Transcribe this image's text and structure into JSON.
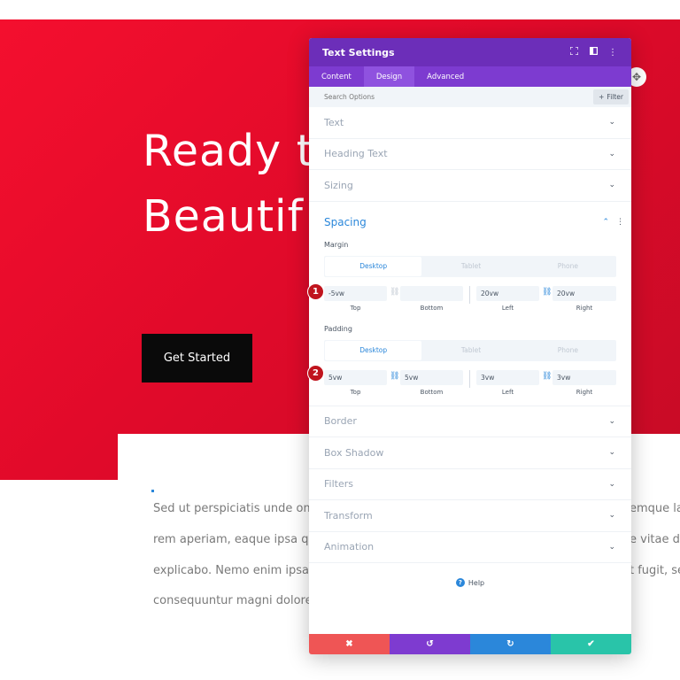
{
  "page": {
    "hero_line1": "Ready t",
    "hero_line2": "Beautif",
    "cta_label": "Get Started",
    "body_lines": [
      "Sed ut perspiciatis unde om",
      "rem aperiam, eaque ipsa q",
      "explicabo. Nemo enim ipsa",
      "consequuntur magni dolore"
    ],
    "body_lines_right": [
      "emque la",
      "e vitae d",
      "t fugit, se"
    ],
    "move_icon": "move-icon"
  },
  "modal": {
    "title": "Text Settings",
    "header_icons": [
      "fullscreen-icon",
      "split-view-icon",
      "more-vertical-icon"
    ],
    "tabs": [
      {
        "label": "Content",
        "active": false
      },
      {
        "label": "Design",
        "active": true
      },
      {
        "label": "Advanced",
        "active": false
      }
    ],
    "search_placeholder": "Search Options",
    "filter_label": "Filter",
    "toggles_top": [
      "Text",
      "Heading Text",
      "Sizing"
    ],
    "spacing": {
      "label": "Spacing",
      "margin": {
        "label": "Margin",
        "devices": [
          "Desktop",
          "Tablet",
          "Phone"
        ],
        "active_device": "Desktop",
        "top": "-5vw",
        "bottom": "",
        "left": "20vw",
        "right": "20vw",
        "top_bottom_linked": false,
        "left_right_linked": true,
        "badge": "1"
      },
      "padding": {
        "label": "Padding",
        "devices": [
          "Desktop",
          "Tablet",
          "Phone"
        ],
        "active_device": "Desktop",
        "top": "5vw",
        "bottom": "5vw",
        "left": "3vw",
        "right": "3vw",
        "top_bottom_linked": true,
        "left_right_linked": true,
        "badge": "2"
      },
      "side_labels": [
        "Top",
        "Bottom",
        "Left",
        "Right"
      ]
    },
    "toggles_bottom": [
      "Border",
      "Box Shadow",
      "Filters",
      "Transform",
      "Animation"
    ],
    "help_label": "Help",
    "footer_buttons": [
      {
        "name": "discard",
        "icon": "✖",
        "color": "#ef5555"
      },
      {
        "name": "undo",
        "icon": "↺",
        "color": "#7e3bd0"
      },
      {
        "name": "redo",
        "icon": "↻",
        "color": "#2b87da"
      },
      {
        "name": "save",
        "icon": "✔",
        "color": "#29c4a9"
      }
    ]
  },
  "colors": {
    "hero_red": "#f40f2e",
    "purple_header": "#6c2eb9",
    "purple_tabs": "#7d3bd0",
    "accent_blue": "#2b87da",
    "badge_red": "#c0141d"
  }
}
